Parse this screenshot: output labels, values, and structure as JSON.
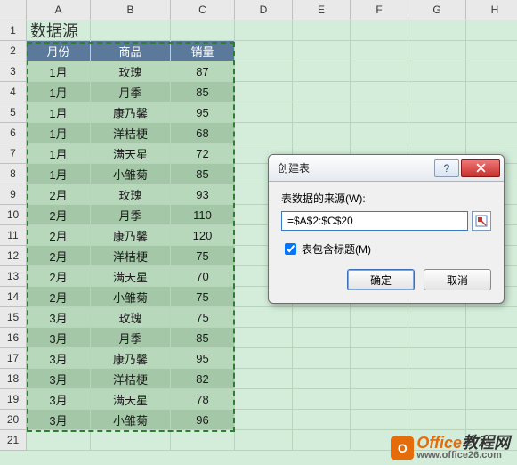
{
  "columns": [
    "A",
    "B",
    "C",
    "D",
    "E",
    "F",
    "G",
    "H"
  ],
  "rows": [
    "1",
    "2",
    "3",
    "4",
    "5",
    "6",
    "7",
    "8",
    "9",
    "10",
    "11",
    "12",
    "13",
    "14",
    "15",
    "16",
    "17",
    "18",
    "19",
    "20",
    "21"
  ],
  "title": "数据源",
  "headers": [
    "月份",
    "商品",
    "销量"
  ],
  "data": [
    [
      "1月",
      "玫瑰",
      "87"
    ],
    [
      "1月",
      "月季",
      "85"
    ],
    [
      "1月",
      "康乃馨",
      "95"
    ],
    [
      "1月",
      "洋桔梗",
      "68"
    ],
    [
      "1月",
      "满天星",
      "72"
    ],
    [
      "1月",
      "小雏菊",
      "85"
    ],
    [
      "2月",
      "玫瑰",
      "93"
    ],
    [
      "2月",
      "月季",
      "110"
    ],
    [
      "2月",
      "康乃馨",
      "120"
    ],
    [
      "2月",
      "洋桔梗",
      "75"
    ],
    [
      "2月",
      "满天星",
      "70"
    ],
    [
      "2月",
      "小雏菊",
      "75"
    ],
    [
      "3月",
      "玫瑰",
      "75"
    ],
    [
      "3月",
      "月季",
      "85"
    ],
    [
      "3月",
      "康乃馨",
      "95"
    ],
    [
      "3月",
      "洋桔梗",
      "82"
    ],
    [
      "3月",
      "满天星",
      "78"
    ],
    [
      "3月",
      "小雏菊",
      "96"
    ]
  ],
  "dialog": {
    "title": "创建表",
    "source_label": "表数据的来源(W):",
    "range": "=$A$2:$C$20",
    "checkbox_label": "表包含标题(M)",
    "checkbox_checked": true,
    "ok": "确定",
    "cancel": "取消"
  },
  "watermark": {
    "brand1": "Office",
    "brand2": "教程网",
    "url": "www.office26.com"
  }
}
